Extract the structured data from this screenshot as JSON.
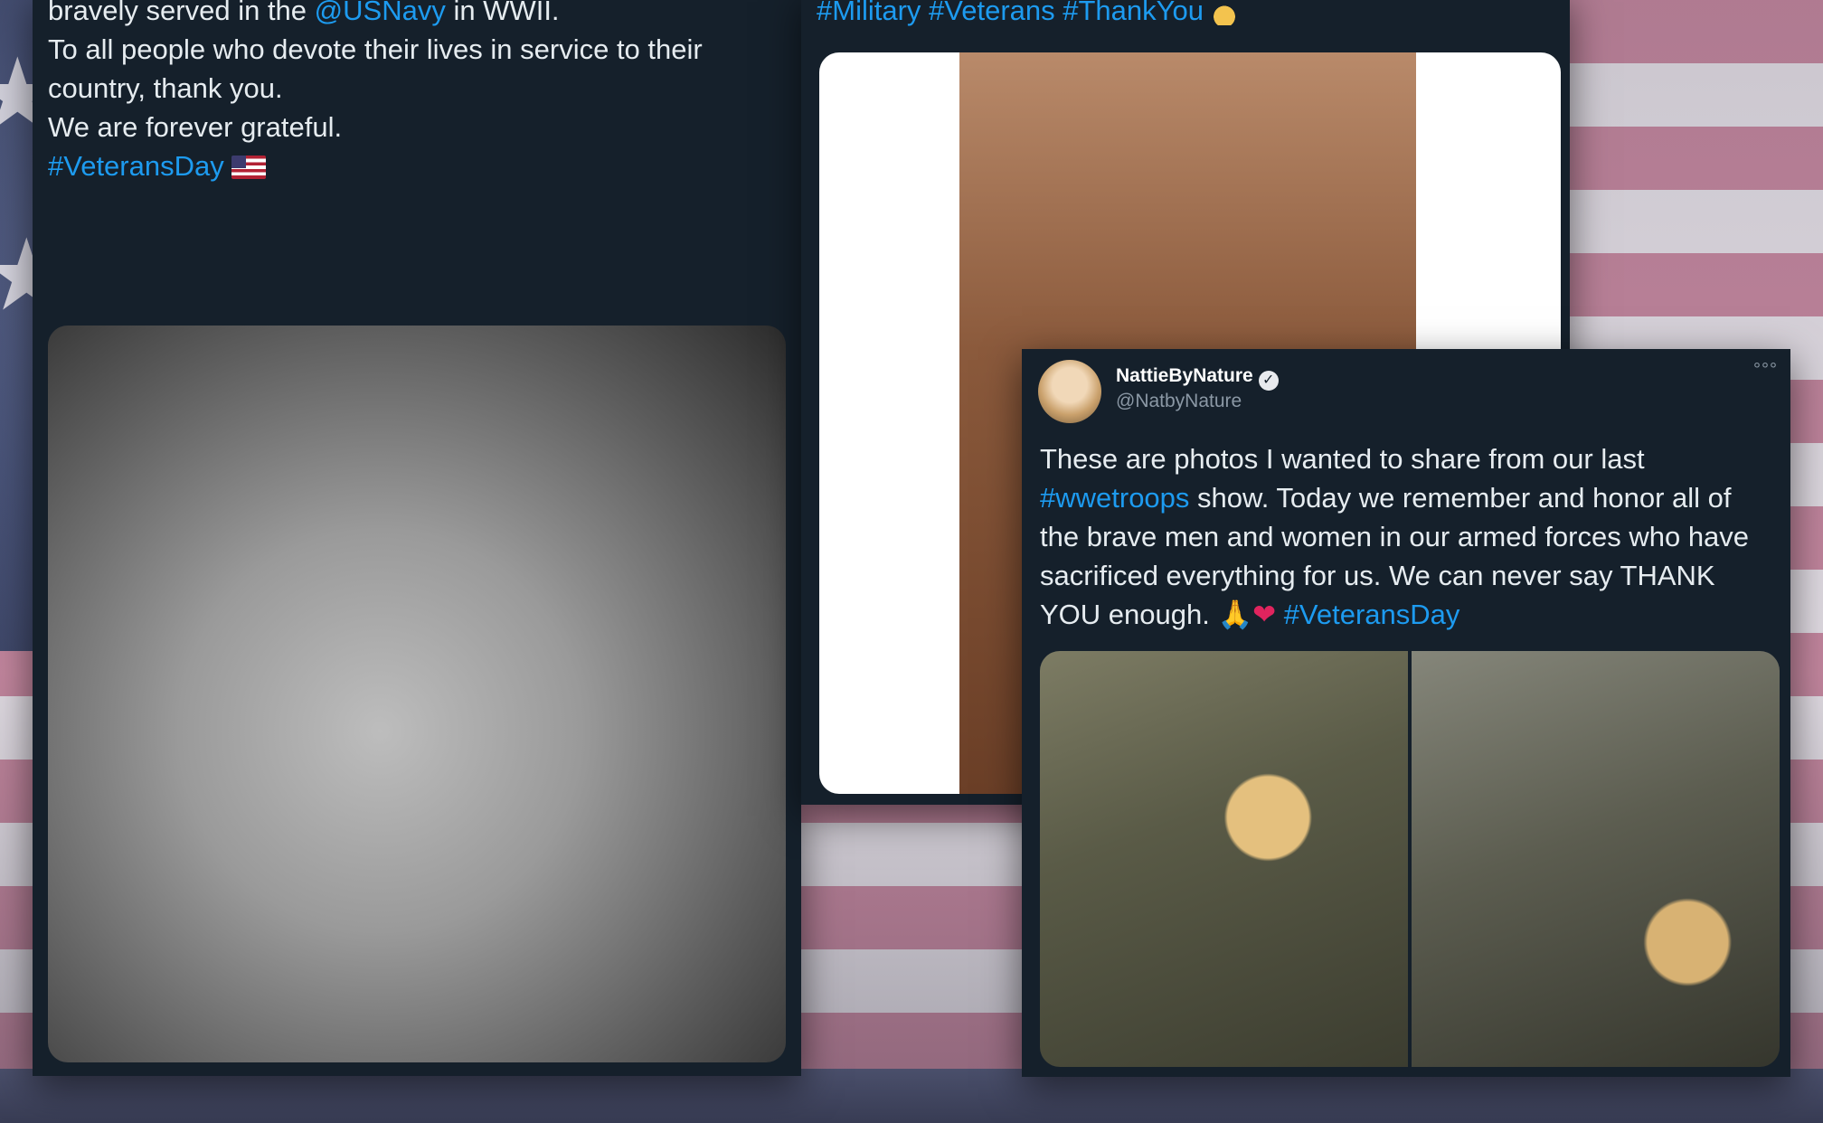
{
  "tweet_left": {
    "line_top_prefix": "bravely served in the ",
    "mention": "@USNavy",
    "line_top_suffix": " in WWII.",
    "paragraph_1": "To all people who devote their lives in service to their country, thank you.",
    "paragraph_2": "We are forever grateful.",
    "hashtag": "#VeteransDay",
    "emoji": "us-flag-emoji"
  },
  "tweet_middle": {
    "hashtags": "#Military #Veterans #ThankYou",
    "emoji": "heart-hands-emoji"
  },
  "tweet_right": {
    "display_name": "NattieByNature",
    "handle": "@NatbyNature",
    "more": "°°°",
    "text_part_1": "These are photos I wanted to share from our last ",
    "hashtag_1": "#wwetroops",
    "text_part_2": " show. Today we remember and honor all of the brave men and women in our armed forces who have sacrificed everything for us. We can never say THANK YOU enough. ",
    "emoji_pray": "🙏",
    "emoji_heart": "❤",
    "hashtag_2": "#VeteransDay"
  },
  "colors": {
    "card_background": "#15202b",
    "link": "#1d9bf0",
    "text": "#e6ecf0",
    "muted": "#8b98a5"
  }
}
